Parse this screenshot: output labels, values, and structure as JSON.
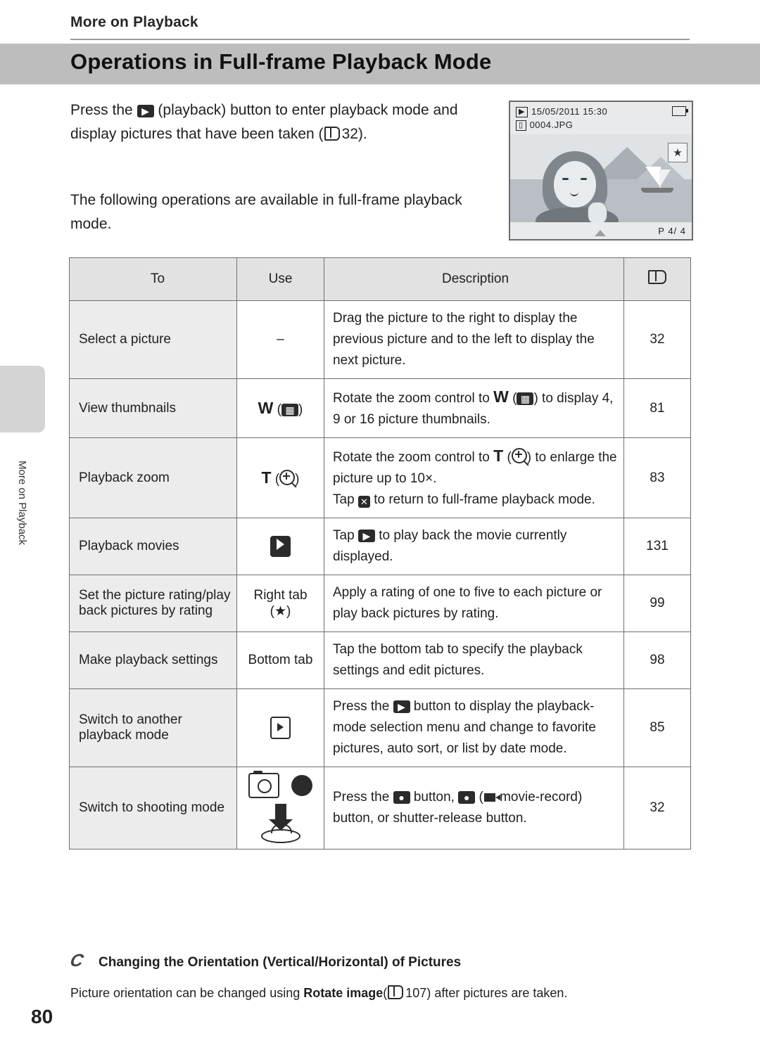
{
  "header": {
    "section": "More on Playback",
    "title": "Operations in Full-frame Playback Mode",
    "side_tab_label": "More on Playback"
  },
  "intro": {
    "paragraph1_a": "Press the",
    "paragraph1_b": "(playback) button to enter playback mode and display pictures that have been taken (",
    "paragraph1_page": "32",
    "paragraph1_c": ").",
    "paragraph2": "The following operations are available in full-frame playback mode."
  },
  "camera_screen": {
    "date": "15/05/2011",
    "time": "15:30",
    "filename": "0004.JPG",
    "frame_counter": "4/   4",
    "star_glyph": "★",
    "print_mark": "P"
  },
  "table": {
    "headers": [
      "To",
      "Use",
      "Description",
      "book-icon"
    ],
    "rows": [
      {
        "to": "Select a picture",
        "use_text": "–",
        "use_type": "dash",
        "description": "Drag the picture to the right to display the previous picture and to the left to display the next picture.",
        "page": "32"
      },
      {
        "to": "View thumbnails",
        "use_text": "W",
        "use_type": "wide-zoom",
        "description_a": "Rotate the zoom control to",
        "description_b": "W",
        "description_c": ") to display 4, 9 or 16 picture thumbnails.",
        "page": "81"
      },
      {
        "to": "Playback zoom",
        "use_text": "T",
        "use_type": "tele-zoom",
        "description_a": "Rotate the zoom control to",
        "description_b": "T",
        "description_c": ") to enlarge the picture up to 10×.",
        "description_d": "Tap",
        "description_e": "to return to full-frame playback mode.",
        "page": "83"
      },
      {
        "to": "Playback movies",
        "use_type": "play-button",
        "description_a": "Tap",
        "description_b": "to play back the movie currently displayed.",
        "page": "131"
      },
      {
        "to": "Set the picture rating/play back pictures by rating",
        "use_text": "Right tab",
        "use_sub": "(★)",
        "use_type": "text",
        "description": "Apply a rating of one to five to each picture or play back pictures by rating.",
        "page": "99"
      },
      {
        "to": "Make playback settings",
        "use_text": "Bottom tab",
        "use_type": "text",
        "description": "Tap the bottom tab to specify the playback settings and edit pictures.",
        "page": "98"
      },
      {
        "to": "Switch to another playback mode",
        "use_type": "playback-mode-button",
        "description_a": "Press the",
        "description_b": "button to display the playback-mode selection menu and change to favorite pictures, auto sort, or list by date mode.",
        "page": "85"
      },
      {
        "to": "Switch to shooting mode",
        "use_type": "shooting-controls",
        "description_a": "Press the",
        "description_b": "button,",
        "description_c": "(",
        "description_d": "movie-record) button, or shutter-release button.",
        "page": "32"
      }
    ]
  },
  "note": {
    "icon": "C",
    "title": "Changing the Orientation (Vertical/Horizontal) of Pictures",
    "body_a": "Picture orientation can be changed using",
    "body_bold": "Rotate image",
    "body_b": "(",
    "body_page": "107",
    "body_c": ") after pictures are taken."
  },
  "footer": {
    "page_number": "80"
  }
}
